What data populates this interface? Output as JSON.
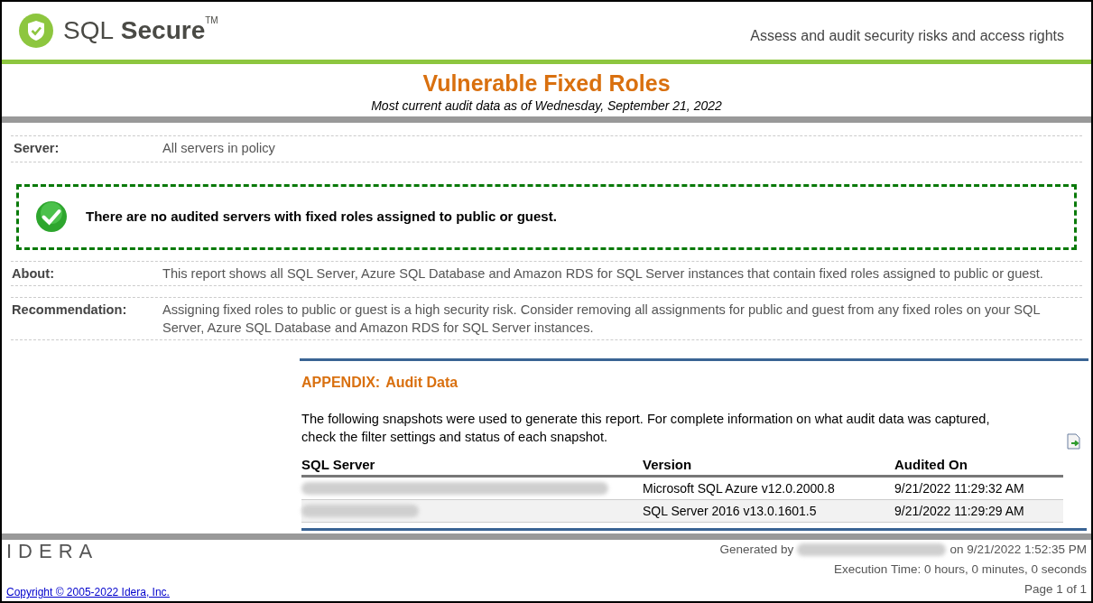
{
  "header": {
    "logo_text": "SQL",
    "logo_text_bold": "Secure",
    "logo_mark": "TM",
    "tagline": "Assess and audit security risks and access rights"
  },
  "report": {
    "title": "Vulnerable Fixed Roles",
    "subtitle": "Most current audit data as of Wednesday, September 21, 2022"
  },
  "server": {
    "label": "Server:",
    "value": "All servers in policy"
  },
  "notice": {
    "text": "There are no audited servers with fixed roles assigned to public or guest."
  },
  "details": [
    {
      "label": "About:",
      "value": "This report shows all SQL Server, Azure SQL Database and Amazon RDS for SQL Server instances that contain fixed roles assigned to public or guest."
    },
    {
      "label": "Recommendation:",
      "value": "Assigning fixed roles to public or guest is a high security risk. Consider removing all assignments for public and guest from any fixed roles on your SQL Server, Azure SQL Database and Amazon RDS for SQL Server instances."
    }
  ],
  "appendix": {
    "label": "APPENDIX:",
    "title": "Audit Data",
    "description": "The following snapshots were used to generate this report. For complete information on what audit data was captured, check the filter settings and status of each snapshot.",
    "columns": [
      "SQL Server",
      "Version",
      "Audited On"
    ],
    "rows": [
      {
        "version": "Microsoft SQL Azure v12.0.2000.8",
        "audited_on": "9/21/2022 11:29:32 AM"
      },
      {
        "version": "SQL Server 2016 v13.0.1601.5",
        "audited_on": "9/21/2022 11:29:29 AM"
      }
    ]
  },
  "footer": {
    "brand": "IDERA",
    "generated_by": "Generated by",
    "generated_on": "on 9/21/2022 1:52:35 PM",
    "execution_time": "Execution Time: 0 hours, 0 minutes, 0 seconds",
    "copyright": "Copyright © 2005-2022 Idera, Inc.",
    "page": "Page 1 of 1"
  }
}
